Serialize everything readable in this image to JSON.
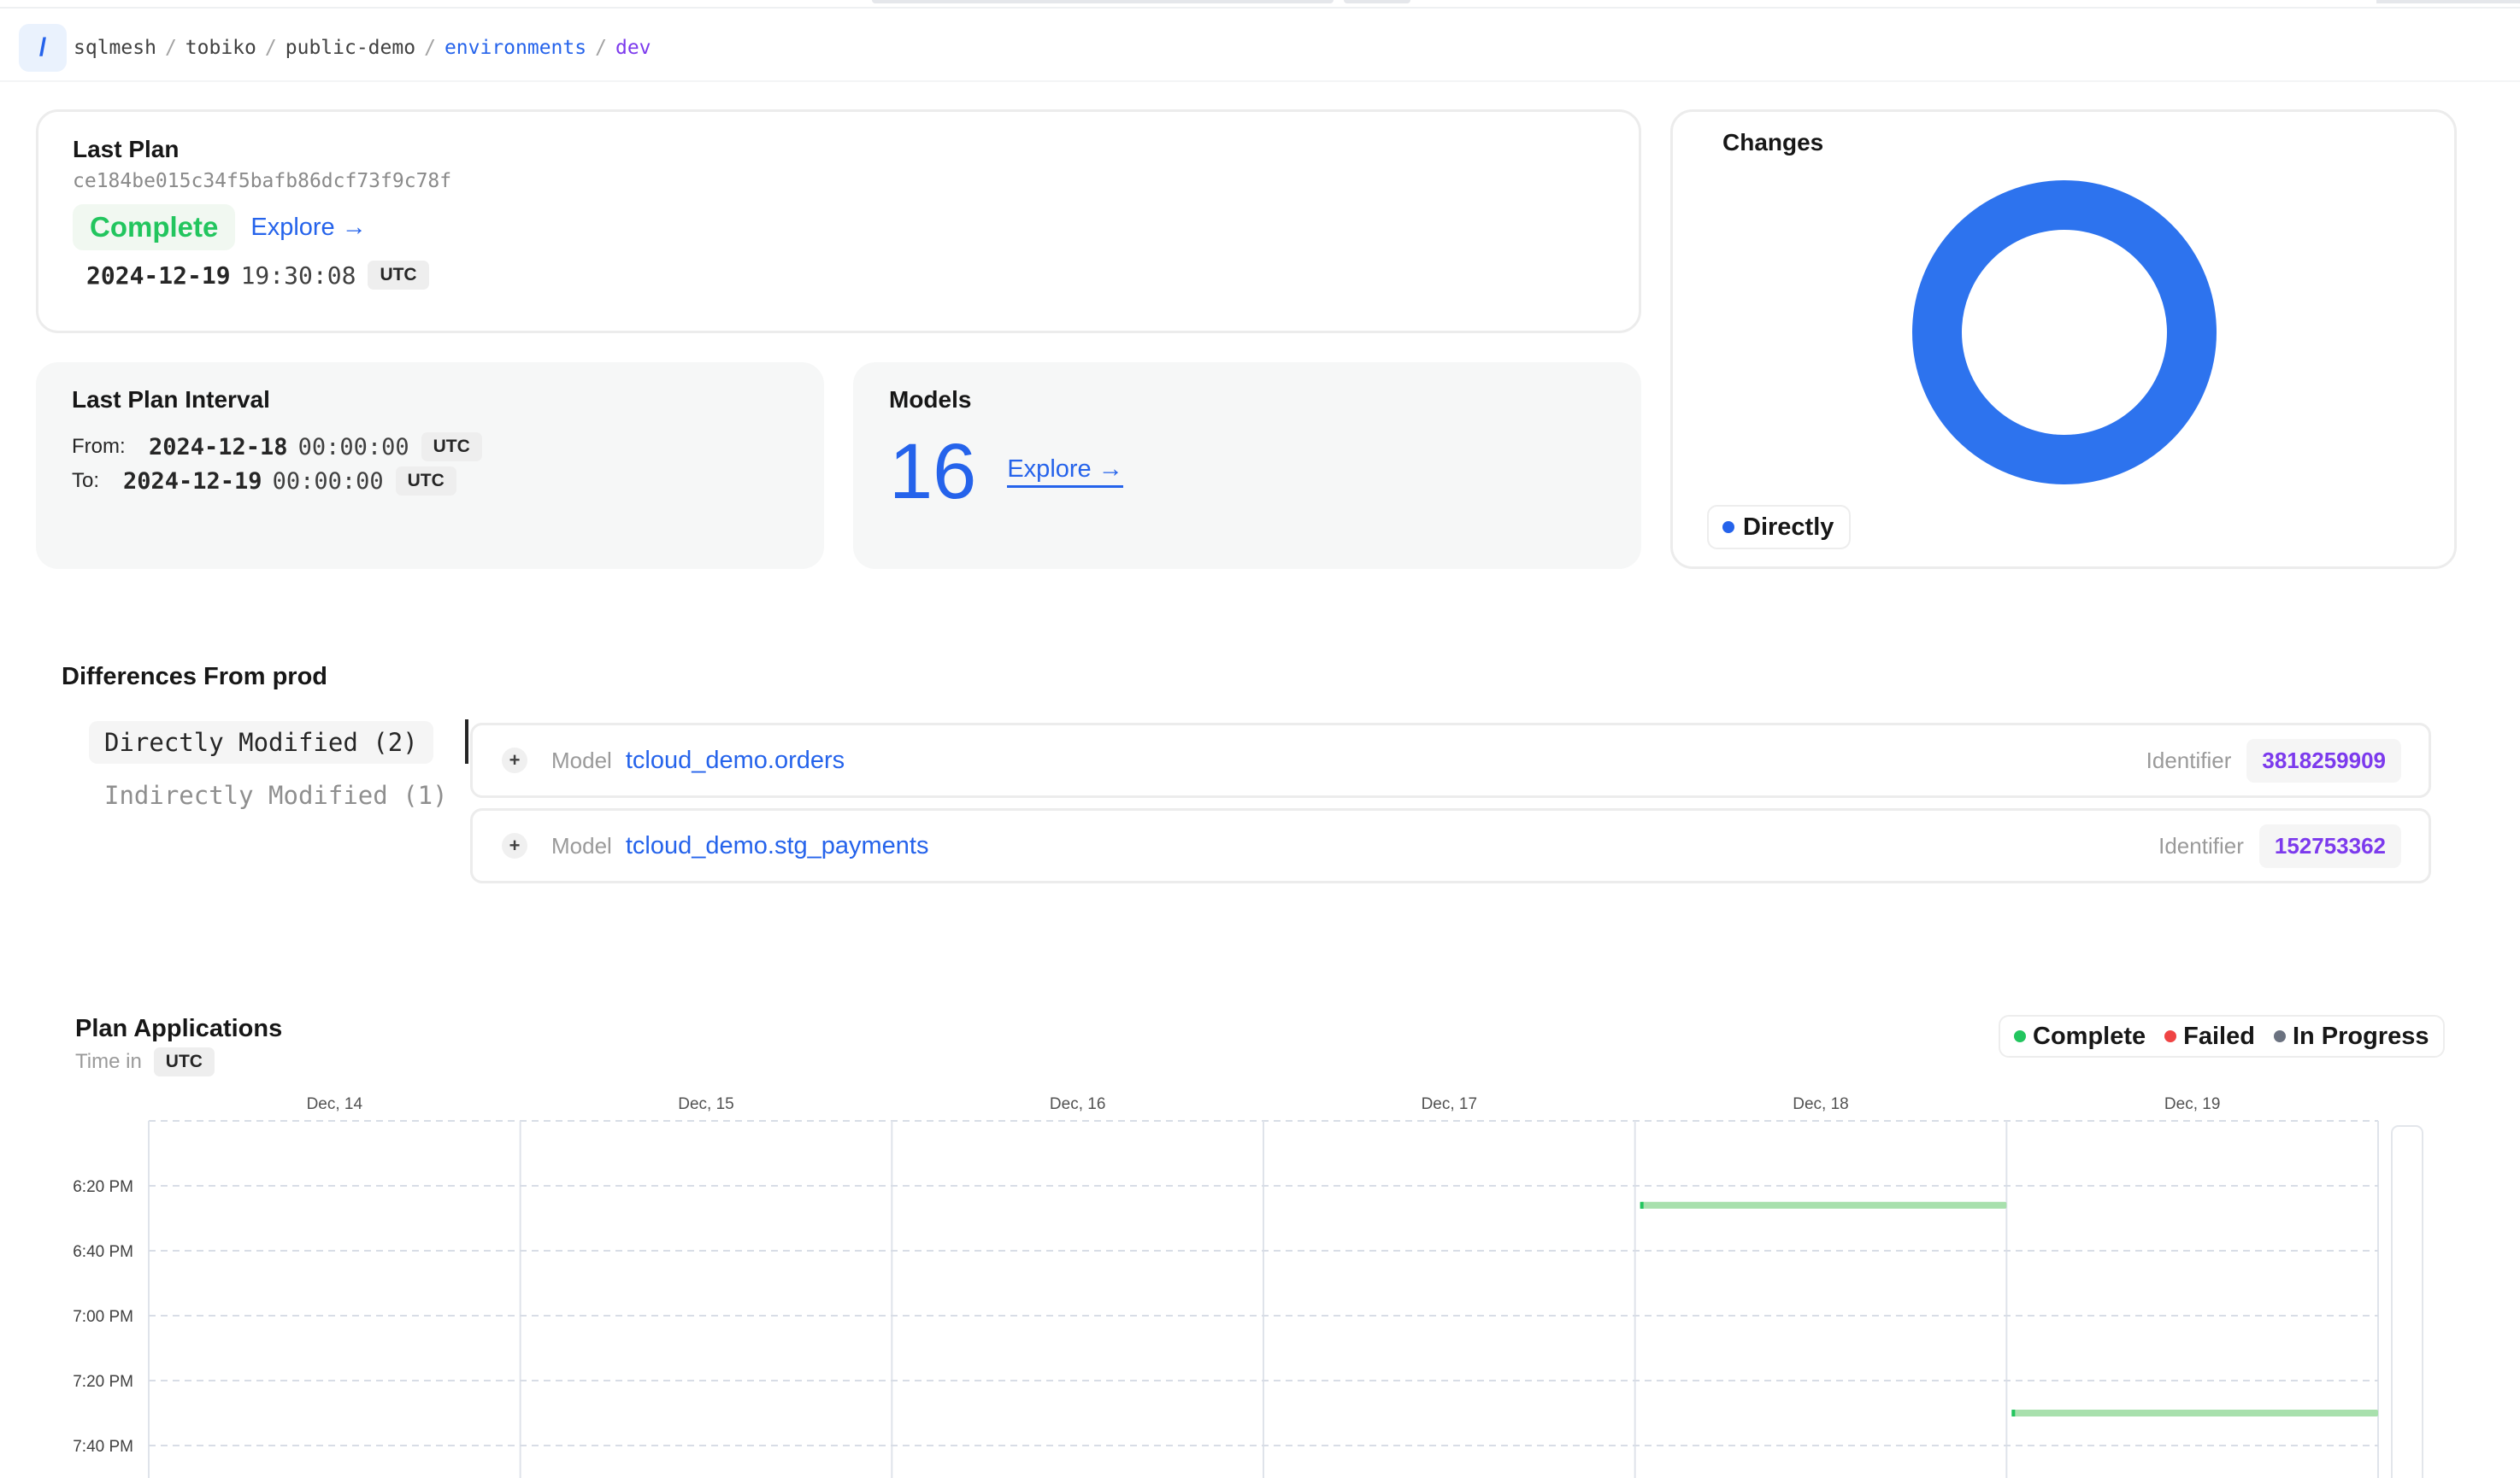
{
  "breadcrumb": {
    "home_symbol": "/",
    "items": [
      "sqlmesh",
      "tobiko",
      "public-demo"
    ],
    "link": "environments",
    "current": "dev",
    "separator": "/"
  },
  "last_plan": {
    "title": "Last Plan",
    "hash": "ce184be015c34f5bafb86dcf73f9c78f",
    "status": "Complete",
    "explore_label": "Explore →",
    "date": "2024-12-19",
    "time": "19:30:08",
    "tz": "UTC"
  },
  "last_plan_interval": {
    "title": "Last Plan Interval",
    "from_label": "From:",
    "from_date": "2024-12-18",
    "from_time": "00:00:00",
    "to_label": "To:",
    "to_date": "2024-12-19",
    "to_time": "00:00:00",
    "tz": "UTC"
  },
  "models": {
    "title": "Models",
    "count": "16",
    "explore_label": "Explore →"
  },
  "changes": {
    "title": "Changes",
    "legend_label": "Directly",
    "color": "#2d73ee"
  },
  "differences": {
    "title": "Differences From prod",
    "filters": [
      "Directly Modified (2)",
      "Indirectly Modified (1)"
    ],
    "kind_label": "Model",
    "identifier_label": "Identifier",
    "rows": [
      {
        "name": "tcloud_demo.orders",
        "identifier": "3818259909"
      },
      {
        "name": "tcloud_demo.stg_payments",
        "identifier": "152753362"
      }
    ]
  },
  "plan_applications": {
    "title": "Plan Applications",
    "time_in_label": "Time in",
    "tz": "UTC",
    "legend": [
      {
        "label": "Complete",
        "color": "#22c55e"
      },
      {
        "label": "Failed",
        "color": "#ef4444"
      },
      {
        "label": "In Progress",
        "color": "#6b7280"
      }
    ]
  },
  "chart_data": {
    "type": "bar",
    "orientation": "timeline",
    "x_categories": [
      "Dec, 14",
      "Dec, 15",
      "Dec, 16",
      "Dec, 17",
      "Dec, 18",
      "Dec, 19"
    ],
    "y_ticks": [
      "6:20 PM",
      "6:40 PM",
      "7:00 PM",
      "7:20 PM",
      "7:40 PM"
    ],
    "bars": [
      {
        "start_day": "Dec, 18",
        "end_day": "Dec, 19",
        "time": "6:26 PM",
        "status": "Complete"
      },
      {
        "start_day": "Dec, 19",
        "end_day": "Dec, 20",
        "time": "7:30 PM",
        "status": "Complete"
      }
    ],
    "grid": true,
    "bar_color": "#a8e0ad"
  }
}
